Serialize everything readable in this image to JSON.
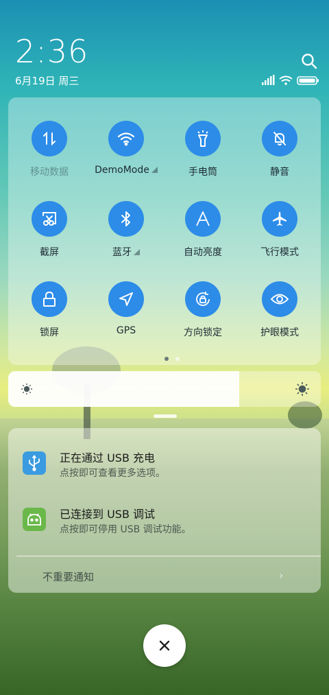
{
  "status": {
    "time": "2:36",
    "date": "6月19日 周三"
  },
  "quick_settings": {
    "tiles": [
      {
        "label": "移动数据",
        "icon": "mobile-data-icon",
        "active": false
      },
      {
        "label": "DemoMode",
        "icon": "wifi-icon",
        "active": true,
        "expandable": true
      },
      {
        "label": "手电筒",
        "icon": "flashlight-icon",
        "active": true
      },
      {
        "label": "静音",
        "icon": "mute-bell-icon",
        "active": true
      },
      {
        "label": "截屏",
        "icon": "screenshot-icon",
        "active": true
      },
      {
        "label": "蓝牙",
        "icon": "bluetooth-icon",
        "active": true,
        "expandable": true
      },
      {
        "label": "自动亮度",
        "icon": "auto-brightness-icon",
        "active": true
      },
      {
        "label": "飞行模式",
        "icon": "airplane-icon",
        "active": true
      },
      {
        "label": "锁屏",
        "icon": "lock-icon",
        "active": true
      },
      {
        "label": "GPS",
        "icon": "gps-icon",
        "active": true
      },
      {
        "label": "方向锁定",
        "icon": "rotation-lock-icon",
        "active": true
      },
      {
        "label": "护眼模式",
        "icon": "eye-icon",
        "active": true
      }
    ],
    "page_count": 2,
    "current_page": 1
  },
  "brightness": {
    "level": 0.74
  },
  "notifications": [
    {
      "title": "正在通过  USB  充电",
      "body": "点按即可查看更多选项。",
      "icon": "usb-icon",
      "icon_color": "#3a9be0"
    },
    {
      "title": "已连接到  USB  调试",
      "body": "点按即可停用 USB 调试功能。",
      "icon": "android-icon",
      "icon_color": "#6ab84a"
    }
  ],
  "unimportant_label": "不重要通知",
  "colors": {
    "accent": "#2d8ce8"
  }
}
